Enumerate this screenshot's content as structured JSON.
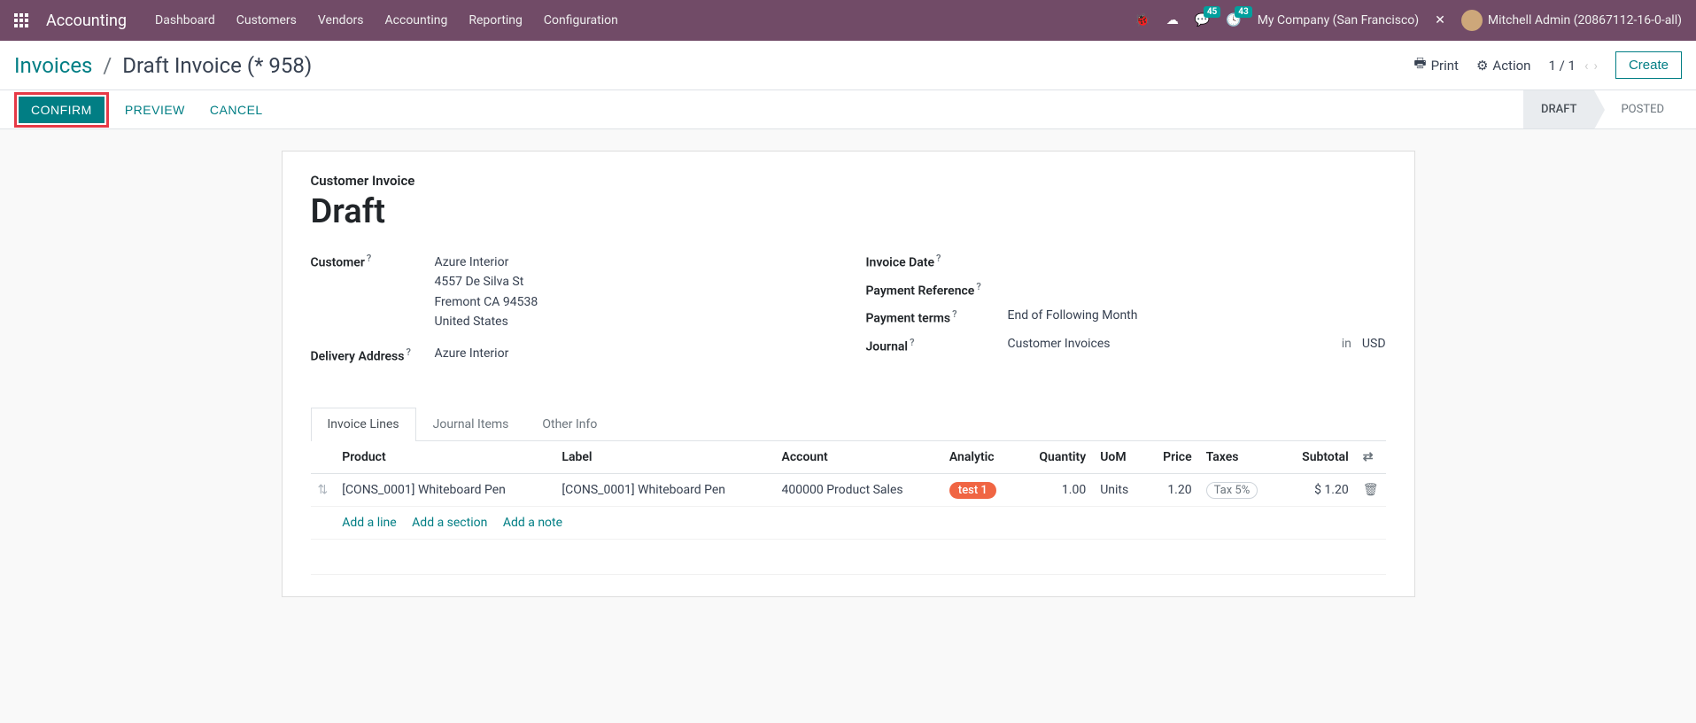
{
  "navbar": {
    "brand": "Accounting",
    "menu": [
      "Dashboard",
      "Customers",
      "Vendors",
      "Accounting",
      "Reporting",
      "Configuration"
    ],
    "messages_badge": "45",
    "activities_badge": "43",
    "company": "My Company (San Francisco)",
    "user": "Mitchell Admin (20867112-16-0-all)"
  },
  "breadcrumb": {
    "root": "Invoices",
    "current": "Draft Invoice (* 958)"
  },
  "controls": {
    "print": "Print",
    "action": "Action",
    "pager": "1 / 1",
    "create": "Create"
  },
  "statusbar": {
    "confirm": "CONFIRM",
    "preview": "PREVIEW",
    "cancel": "CANCEL",
    "draft": "DRAFT",
    "posted": "POSTED"
  },
  "form": {
    "type_label": "Customer Invoice",
    "title": "Draft",
    "customer_label": "Customer",
    "customer_name": "Azure Interior",
    "customer_street": "4557 De Silva St",
    "customer_city": "Fremont CA 94538",
    "customer_country": "United States",
    "delivery_label": "Delivery Address",
    "delivery_value": "Azure Interior",
    "invoice_date_label": "Invoice Date",
    "payment_ref_label": "Payment Reference",
    "payment_terms_label": "Payment terms",
    "payment_terms_value": "End of Following Month",
    "journal_label": "Journal",
    "journal_value": "Customer Invoices",
    "journal_in": "in",
    "journal_currency": "USD"
  },
  "tabs": [
    "Invoice Lines",
    "Journal Items",
    "Other Info"
  ],
  "table": {
    "headers": {
      "product": "Product",
      "label": "Label",
      "account": "Account",
      "analytic": "Analytic",
      "quantity": "Quantity",
      "uom": "UoM",
      "price": "Price",
      "taxes": "Taxes",
      "subtotal": "Subtotal"
    },
    "row": {
      "product": "[CONS_0001] Whiteboard Pen",
      "label": "[CONS_0001] Whiteboard Pen",
      "account": "400000 Product Sales",
      "analytic": "test 1",
      "quantity": "1.00",
      "uom": "Units",
      "price": "1.20",
      "tax": "Tax 5%",
      "subtotal": "$ 1.20"
    },
    "add_line": "Add a line",
    "add_section": "Add a section",
    "add_note": "Add a note"
  }
}
